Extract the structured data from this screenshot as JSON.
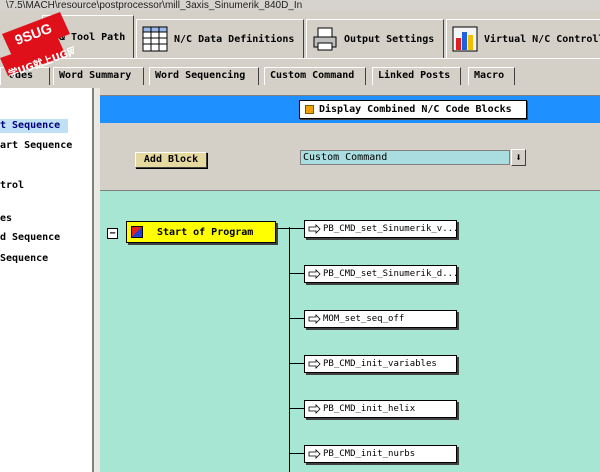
{
  "window": {
    "title_fragment": "\\7.5\\MACH\\resource\\postprocessor\\mill_3axis_Sinumerik_840D_In"
  },
  "logo": {
    "line1": "9SUG",
    "line2": "学UG就上UG网"
  },
  "main_tabs": [
    {
      "label": "& Tool Path",
      "icon": "machine-icon"
    },
    {
      "label": "N/C Data Definitions",
      "icon": "data-grid-icon"
    },
    {
      "label": "Output Settings",
      "icon": "printer-icon"
    },
    {
      "label": "Virtual N/C Controller",
      "icon": "bar-chart-icon"
    }
  ],
  "sub_tabs": [
    {
      "label": "odes"
    },
    {
      "label": "Word Summary"
    },
    {
      "label": "Word Sequencing"
    },
    {
      "label": "Custom Command"
    },
    {
      "label": "Linked Posts"
    },
    {
      "label": "Macro"
    }
  ],
  "left_panel": {
    "items": [
      {
        "label": "t Sequence",
        "selected": true
      },
      {
        "label": "art Sequence",
        "selected": false
      },
      {
        "label": "trol",
        "selected": false
      },
      {
        "label": "es",
        "selected": false
      },
      {
        "label": "d Sequence",
        "selected": false
      },
      {
        "label": "Sequence",
        "selected": false
      }
    ]
  },
  "toolbar": {
    "display_combined_label": "Display Combined N/C Code Blocks",
    "add_block_label": "Add Block",
    "block_type_value": "Custom Command",
    "dropdown_arrow": "⬇"
  },
  "sequence": {
    "collapse_symbol": "−",
    "start_label": "Start of Program",
    "commands": [
      {
        "label": "PB_CMD_set_Sinumerik_v..."
      },
      {
        "label": "PB_CMD_set_Sinumerik_d..."
      },
      {
        "label": "MOM_set_seq_off"
      },
      {
        "label": "PB_CMD_init_variables"
      },
      {
        "label": "PB_CMD_init_helix"
      },
      {
        "label": "PB_CMD_init_nurbs"
      }
    ]
  },
  "colors": {
    "blue_bar": "#1e90ff",
    "canvas": "#a8e6d4",
    "start_box": "#ffff00",
    "add_block": "#e6d9a0",
    "logo_red": "#e0101a"
  }
}
